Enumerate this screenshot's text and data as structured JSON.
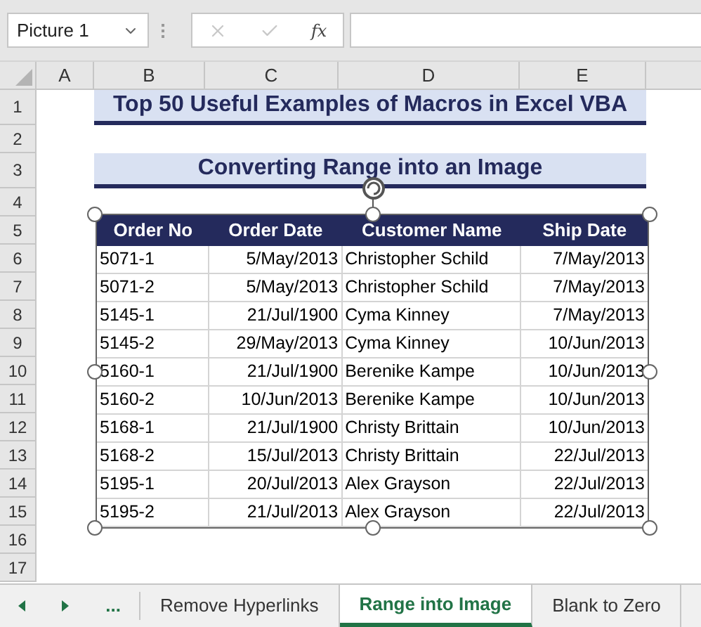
{
  "name_box": {
    "value": "Picture 1"
  },
  "formula_bar": {
    "insert_function": "fx",
    "cancel_disabled": true,
    "enter_disabled": true
  },
  "columns": [
    "A",
    "B",
    "C",
    "D",
    "E"
  ],
  "rows": [
    "1",
    "2",
    "3",
    "4",
    "5",
    "6",
    "7",
    "8",
    "9",
    "10",
    "11",
    "12",
    "13",
    "14",
    "15",
    "16",
    "17"
  ],
  "title": "Top 50 Useful Examples of Macros in Excel VBA",
  "subtitle": "Converting Range into an Image",
  "picture": {
    "selected": true,
    "headers": [
      "Order No",
      "Order Date",
      "Customer Name",
      "Ship Date"
    ],
    "rows": [
      [
        "5071-1",
        "5/May/2013",
        "Christopher Schild",
        "7/May/2013"
      ],
      [
        "5071-2",
        "5/May/2013",
        "Christopher Schild",
        "7/May/2013"
      ],
      [
        "5145-1",
        "21/Jul/1900",
        "Cyma Kinney",
        "7/May/2013"
      ],
      [
        "5145-2",
        "29/May/2013",
        "Cyma Kinney",
        "10/Jun/2013"
      ],
      [
        "5160-1",
        "21/Jul/1900",
        "Berenike Kampe",
        "10/Jun/2013"
      ],
      [
        "5160-2",
        "10/Jun/2013",
        "Berenike Kampe",
        "10/Jun/2013"
      ],
      [
        "5168-1",
        "21/Jul/1900",
        "Christy Brittain",
        "10/Jun/2013"
      ],
      [
        "5168-2",
        "15/Jul/2013",
        "Christy Brittain",
        "22/Jul/2013"
      ],
      [
        "5195-1",
        "20/Jul/2013",
        "Alex Grayson",
        "22/Jul/2013"
      ],
      [
        "5195-2",
        "21/Jul/2013",
        "Alex Grayson",
        "22/Jul/2013"
      ]
    ]
  },
  "sheet_nav": {
    "more": "..."
  },
  "tabs": [
    {
      "label": "Remove Hyperlinks",
      "selected": false
    },
    {
      "label": "Range into Image",
      "selected": true
    },
    {
      "label": "Blank to Zero",
      "selected": false
    }
  ]
}
